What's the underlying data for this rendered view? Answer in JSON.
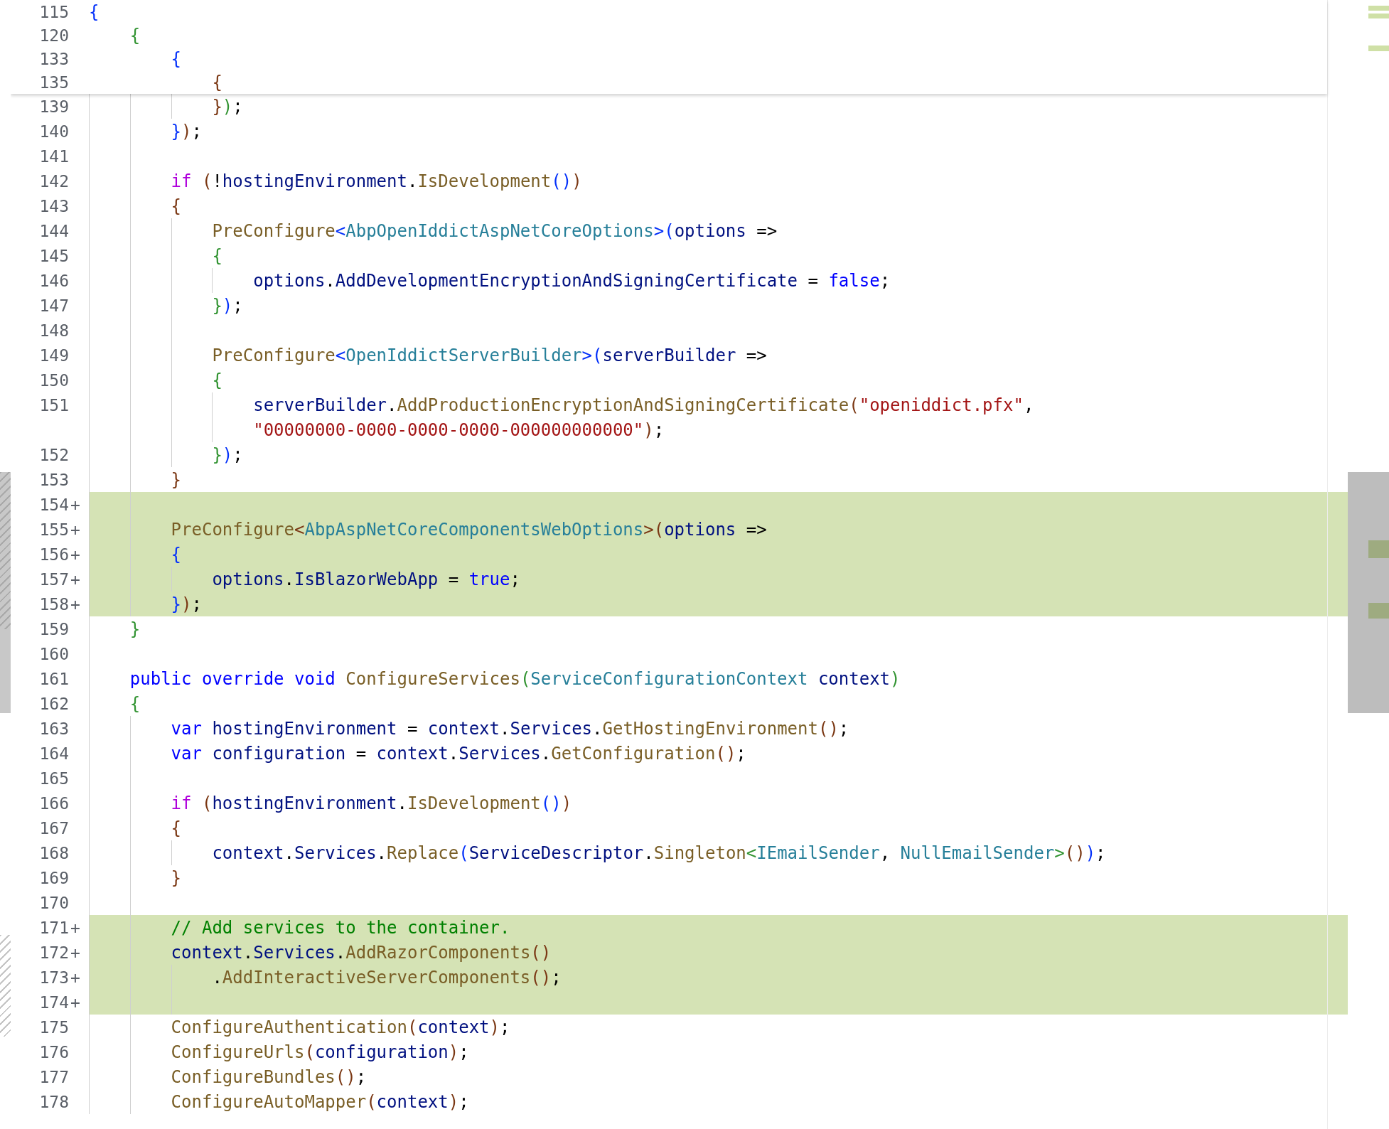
{
  "lines": [
    {
      "number": "115",
      "sticky": true,
      "added": false,
      "tokens": [
        {
          "t": "{",
          "kind": "b1"
        }
      ],
      "children": [
        {
          "number": "120",
          "sticky": true,
          "added": false,
          "tokens": [
            {
              "t": "{",
              "kind": "b2"
            }
          ],
          "children": [
            {
              "number": "133",
              "sticky": true,
              "added": false,
              "tokens": [
                {
                  "t": "{",
                  "kind": "b1"
                }
              ],
              "children": [
                {
                  "number": "135",
                  "sticky": true,
                  "added": false,
                  "tokens": [
                    {
                      "t": "{",
                      "kind": "b3"
                    }
                  ]
                },
                {
                  "number": "139",
                  "sticky": false,
                  "added": false,
                  "tokens": [
                    {
                      "t": "}",
                      "kind": "b3"
                    },
                    {
                      "t": ")",
                      "kind": "b2"
                    },
                    {
                      "t": ";",
                      "kind": "p"
                    }
                  ]
                }
              ]
            },
            {
              "number": "140",
              "sticky": false,
              "added": false,
              "tokens": [
                {
                  "t": "}",
                  "kind": "b1"
                },
                {
                  "t": ")",
                  "kind": "b3"
                },
                {
                  "t": ";",
                  "kind": "p"
                }
              ]
            },
            {
              "number": "141",
              "sticky": false,
              "added": false
            },
            {
              "number": "142",
              "sticky": false,
              "added": false,
              "tokens": [
                {
                  "t": "if",
                  "kind": "ctrl"
                },
                {
                  "t": " (",
                  "kind": "b3"
                },
                {
                  "t": "!",
                  "kind": "p"
                },
                {
                  "t": "hostingEnvironment",
                  "kind": "id"
                },
                {
                  "t": ".",
                  "kind": "p"
                },
                {
                  "t": "IsDevelopment",
                  "kind": "fn"
                },
                {
                  "t": "()",
                  "kind": "b1"
                },
                {
                  "t": ")",
                  "kind": "b3"
                }
              ]
            },
            {
              "number": "143",
              "sticky": false,
              "added": false,
              "tokens": [
                {
                  "t": "{",
                  "kind": "b3"
                }
              ],
              "children": [
                {
                  "number": "144",
                  "sticky": false,
                  "added": false,
                  "tokens": [
                    {
                      "t": "PreConfigure",
                      "kind": "fn"
                    },
                    {
                      "t": "<",
                      "kind": "b1"
                    },
                    {
                      "t": "AbpOpenIddictAspNetCoreOptions",
                      "kind": "ty"
                    },
                    {
                      "t": ">(",
                      "kind": "b1"
                    },
                    {
                      "t": "options",
                      "kind": "id"
                    },
                    {
                      "t": " =>",
                      "kind": "p"
                    }
                  ]
                },
                {
                  "number": "145",
                  "sticky": false,
                  "added": false,
                  "tokens": [
                    {
                      "t": "{",
                      "kind": "b2"
                    }
                  ],
                  "children": [
                    {
                      "number": "146",
                      "sticky": false,
                      "added": false,
                      "tokens": [
                        {
                          "t": "options",
                          "kind": "id"
                        },
                        {
                          "t": ".",
                          "kind": "p"
                        },
                        {
                          "t": "AddDevelopmentEncryptionAndSigningCertificate",
                          "kind": "id"
                        },
                        {
                          "t": " = ",
                          "kind": "p"
                        },
                        {
                          "t": "false",
                          "kind": "kw"
                        },
                        {
                          "t": ";",
                          "kind": "p"
                        }
                      ]
                    }
                  ]
                },
                {
                  "number": "147",
                  "sticky": false,
                  "added": false,
                  "tokens": [
                    {
                      "t": "}",
                      "kind": "b2"
                    },
                    {
                      "t": ")",
                      "kind": "b1"
                    },
                    {
                      "t": ";",
                      "kind": "p"
                    }
                  ]
                },
                {
                  "number": "148",
                  "sticky": false,
                  "added": false
                },
                {
                  "number": "149",
                  "sticky": false,
                  "added": false,
                  "tokens": [
                    {
                      "t": "PreConfigure",
                      "kind": "fn"
                    },
                    {
                      "t": "<",
                      "kind": "b1"
                    },
                    {
                      "t": "OpenIddictServerBuilder",
                      "kind": "ty"
                    },
                    {
                      "t": ">(",
                      "kind": "b1"
                    },
                    {
                      "t": "serverBuilder",
                      "kind": "id"
                    },
                    {
                      "t": " =>",
                      "kind": "p"
                    }
                  ]
                },
                {
                  "number": "150",
                  "sticky": false,
                  "added": false,
                  "tokens": [
                    {
                      "t": "{",
                      "kind": "b2"
                    }
                  ],
                  "children": [
                    {
                      "number": "151",
                      "sticky": false,
                      "added": false,
                      "tokens": [
                        {
                          "t": "serverBuilder",
                          "kind": "id"
                        },
                        {
                          "t": ".",
                          "kind": "p"
                        },
                        {
                          "t": "AddProductionEncryptionAndSigningCertificate",
                          "kind": "fn"
                        },
                        {
                          "t": "(",
                          "kind": "b3"
                        },
                        {
                          "t": "\"openiddict.pfx\"",
                          "kind": "str"
                        },
                        {
                          "t": ",",
                          "kind": "p"
                        }
                      ],
                      "continuation": [
                        {
                          "t": "\"00000000-0000-0000-0000-000000000000\"",
                          "kind": "str"
                        },
                        {
                          "t": ")",
                          "kind": "b3"
                        },
                        {
                          "t": ";",
                          "kind": "p"
                        }
                      ]
                    }
                  ]
                },
                {
                  "number": "152",
                  "sticky": false,
                  "added": false,
                  "tokens": [
                    {
                      "t": "}",
                      "kind": "b2"
                    },
                    {
                      "t": ")",
                      "kind": "b1"
                    },
                    {
                      "t": ";",
                      "kind": "p"
                    }
                  ]
                }
              ]
            },
            {
              "number": "153",
              "sticky": false,
              "added": false,
              "tokens": [
                {
                  "t": "}",
                  "kind": "b3"
                }
              ]
            },
            {
              "number": "154",
              "sign": "+",
              "sticky": false,
              "added": true
            },
            {
              "number": "155",
              "sign": "+",
              "sticky": false,
              "added": true,
              "tokens": [
                {
                  "t": "PreConfigure",
                  "kind": "fn"
                },
                {
                  "t": "<",
                  "kind": "b3"
                },
                {
                  "t": "AbpAspNetCoreComponentsWebOptions",
                  "kind": "ty"
                },
                {
                  "t": ">(",
                  "kind": "b3"
                },
                {
                  "t": "options",
                  "kind": "id"
                },
                {
                  "t": " =>",
                  "kind": "p"
                }
              ]
            },
            {
              "number": "156",
              "sign": "+",
              "sticky": false,
              "added": true,
              "tokens": [
                {
                  "t": "{",
                  "kind": "b1"
                }
              ],
              "children": [
                {
                  "number": "157",
                  "sign": "+",
                  "sticky": false,
                  "added": true,
                  "tokens": [
                    {
                      "t": "options",
                      "kind": "id"
                    },
                    {
                      "t": ".",
                      "kind": "p"
                    },
                    {
                      "t": "IsBlazorWebApp",
                      "kind": "id"
                    },
                    {
                      "t": " = ",
                      "kind": "p"
                    },
                    {
                      "t": "true",
                      "kind": "kw"
                    },
                    {
                      "t": ";",
                      "kind": "p"
                    }
                  ]
                }
              ]
            },
            {
              "number": "158",
              "sign": "+",
              "sticky": false,
              "added": true,
              "tokens": [
                {
                  "t": "}",
                  "kind": "b1"
                },
                {
                  "t": ")",
                  "kind": "b3"
                },
                {
                  "t": ";",
                  "kind": "p"
                }
              ]
            }
          ]
        },
        {
          "number": "159",
          "sticky": false,
          "added": false,
          "tokens": [
            {
              "t": "}",
              "kind": "b2"
            }
          ]
        },
        {
          "number": "160",
          "sticky": false,
          "added": false
        },
        {
          "number": "161",
          "sticky": false,
          "added": false,
          "tokens": [
            {
              "t": "public override void ",
              "kind": "kw"
            },
            {
              "t": "ConfigureServices",
              "kind": "fn"
            },
            {
              "t": "(",
              "kind": "b2"
            },
            {
              "t": "ServiceConfigurationContext ",
              "kind": "ty"
            },
            {
              "t": "context",
              "kind": "id"
            },
            {
              "t": ")",
              "kind": "b2"
            }
          ]
        },
        {
          "number": "162",
          "sticky": false,
          "added": false,
          "tokens": [
            {
              "t": "{",
              "kind": "b2"
            }
          ],
          "children": [
            {
              "number": "163",
              "sticky": false,
              "added": false,
              "tokens": [
                {
                  "t": "var ",
                  "kind": "kw"
                },
                {
                  "t": "hostingEnvironment",
                  "kind": "id"
                },
                {
                  "t": " = ",
                  "kind": "p"
                },
                {
                  "t": "context",
                  "kind": "id"
                },
                {
                  "t": ".",
                  "kind": "p"
                },
                {
                  "t": "Services",
                  "kind": "id"
                },
                {
                  "t": ".",
                  "kind": "p"
                },
                {
                  "t": "GetHostingEnvironment",
                  "kind": "fn"
                },
                {
                  "t": "()",
                  "kind": "b3"
                },
                {
                  "t": ";",
                  "kind": "p"
                }
              ]
            },
            {
              "number": "164",
              "sticky": false,
              "added": false,
              "tokens": [
                {
                  "t": "var ",
                  "kind": "kw"
                },
                {
                  "t": "configuration",
                  "kind": "id"
                },
                {
                  "t": " = ",
                  "kind": "p"
                },
                {
                  "t": "context",
                  "kind": "id"
                },
                {
                  "t": ".",
                  "kind": "p"
                },
                {
                  "t": "Services",
                  "kind": "id"
                },
                {
                  "t": ".",
                  "kind": "p"
                },
                {
                  "t": "GetConfiguration",
                  "kind": "fn"
                },
                {
                  "t": "()",
                  "kind": "b3"
                },
                {
                  "t": ";",
                  "kind": "p"
                }
              ]
            },
            {
              "number": "165",
              "sticky": false,
              "added": false
            },
            {
              "number": "166",
              "sticky": false,
              "added": false,
              "tokens": [
                {
                  "t": "if",
                  "kind": "ctrl"
                },
                {
                  "t": " (",
                  "kind": "b3"
                },
                {
                  "t": "hostingEnvironment",
                  "kind": "id"
                },
                {
                  "t": ".",
                  "kind": "p"
                },
                {
                  "t": "IsDevelopment",
                  "kind": "fn"
                },
                {
                  "t": "()",
                  "kind": "b1"
                },
                {
                  "t": ")",
                  "kind": "b3"
                }
              ]
            },
            {
              "number": "167",
              "sticky": false,
              "added": false,
              "tokens": [
                {
                  "t": "{",
                  "kind": "b3"
                }
              ],
              "children": [
                {
                  "number": "168",
                  "sticky": false,
                  "added": false,
                  "tokens": [
                    {
                      "t": "context",
                      "kind": "id"
                    },
                    {
                      "t": ".",
                      "kind": "p"
                    },
                    {
                      "t": "Services",
                      "kind": "id"
                    },
                    {
                      "t": ".",
                      "kind": "p"
                    },
                    {
                      "t": "Replace",
                      "kind": "fn"
                    },
                    {
                      "t": "(",
                      "kind": "b1"
                    },
                    {
                      "t": "ServiceDescriptor",
                      "kind": "id"
                    },
                    {
                      "t": ".",
                      "kind": "p"
                    },
                    {
                      "t": "Singleton",
                      "kind": "fn"
                    },
                    {
                      "t": "<",
                      "kind": "b2"
                    },
                    {
                      "t": "IEmailSender",
                      "kind": "ty"
                    },
                    {
                      "t": ", ",
                      "kind": "p"
                    },
                    {
                      "t": "NullEmailSender",
                      "kind": "ty"
                    },
                    {
                      "t": ">",
                      "kind": "b2"
                    },
                    {
                      "t": "()",
                      "kind": "b3"
                    },
                    {
                      "t": ")",
                      "kind": "b1"
                    },
                    {
                      "t": ";",
                      "kind": "p"
                    }
                  ]
                }
              ]
            },
            {
              "number": "169",
              "sticky": false,
              "added": false,
              "tokens": [
                {
                  "t": "}",
                  "kind": "b3"
                }
              ]
            },
            {
              "number": "170",
              "sticky": false,
              "added": false
            },
            {
              "number": "171",
              "sign": "+",
              "sticky": false,
              "added": true,
              "tokens": [
                {
                  "t": "// Add services to the container.",
                  "kind": "cm"
                }
              ]
            },
            {
              "number": "172",
              "sign": "+",
              "sticky": false,
              "added": true,
              "tokens": [
                {
                  "t": "context",
                  "kind": "id"
                },
                {
                  "t": ".",
                  "kind": "p"
                },
                {
                  "t": "Services",
                  "kind": "id"
                },
                {
                  "t": ".",
                  "kind": "p"
                },
                {
                  "t": "AddRazorComponents",
                  "kind": "fn"
                },
                {
                  "t": "()",
                  "kind": "b3"
                }
              ],
              "children": [
                {
                  "number": "173",
                  "sign": "+",
                  "sticky": false,
                  "added": true,
                  "tokens": [
                    {
                      "t": ".",
                      "kind": "p"
                    },
                    {
                      "t": "AddInteractiveServerComponents",
                      "kind": "fn"
                    },
                    {
                      "t": "()",
                      "kind": "b3"
                    },
                    {
                      "t": ";",
                      "kind": "p"
                    }
                  ]
                }
              ]
            },
            {
              "number": "174",
              "sign": "+",
              "sticky": false,
              "added": true
            },
            {
              "number": "175",
              "sticky": false,
              "added": false,
              "tokens": [
                {
                  "t": "ConfigureAuthentication",
                  "kind": "fn"
                },
                {
                  "t": "(",
                  "kind": "b3"
                },
                {
                  "t": "context",
                  "kind": "id"
                },
                {
                  "t": ")",
                  "kind": "b3"
                },
                {
                  "t": ";",
                  "kind": "p"
                }
              ]
            },
            {
              "number": "176",
              "sticky": false,
              "added": false,
              "tokens": [
                {
                  "t": "ConfigureUrls",
                  "kind": "fn"
                },
                {
                  "t": "(",
                  "kind": "b3"
                },
                {
                  "t": "configuration",
                  "kind": "id"
                },
                {
                  "t": ")",
                  "kind": "b3"
                },
                {
                  "t": ";",
                  "kind": "p"
                }
              ]
            },
            {
              "number": "177",
              "sticky": false,
              "added": false,
              "tokens": [
                {
                  "t": "ConfigureBundles",
                  "kind": "fn"
                },
                {
                  "t": "()",
                  "kind": "b3"
                },
                {
                  "t": ";",
                  "kind": "p"
                }
              ]
            },
            {
              "number": "178",
              "sticky": false,
              "added": false,
              "tokens": [
                {
                  "t": "ConfigureAutoMapper",
                  "kind": "fn"
                },
                {
                  "t": "(",
                  "kind": "b3"
                },
                {
                  "t": "context",
                  "kind": "id"
                },
                {
                  "t": ")",
                  "kind": "b3"
                },
                {
                  "t": ";",
                  "kind": "p"
                }
              ]
            }
          ]
        }
      ]
    }
  ]
}
